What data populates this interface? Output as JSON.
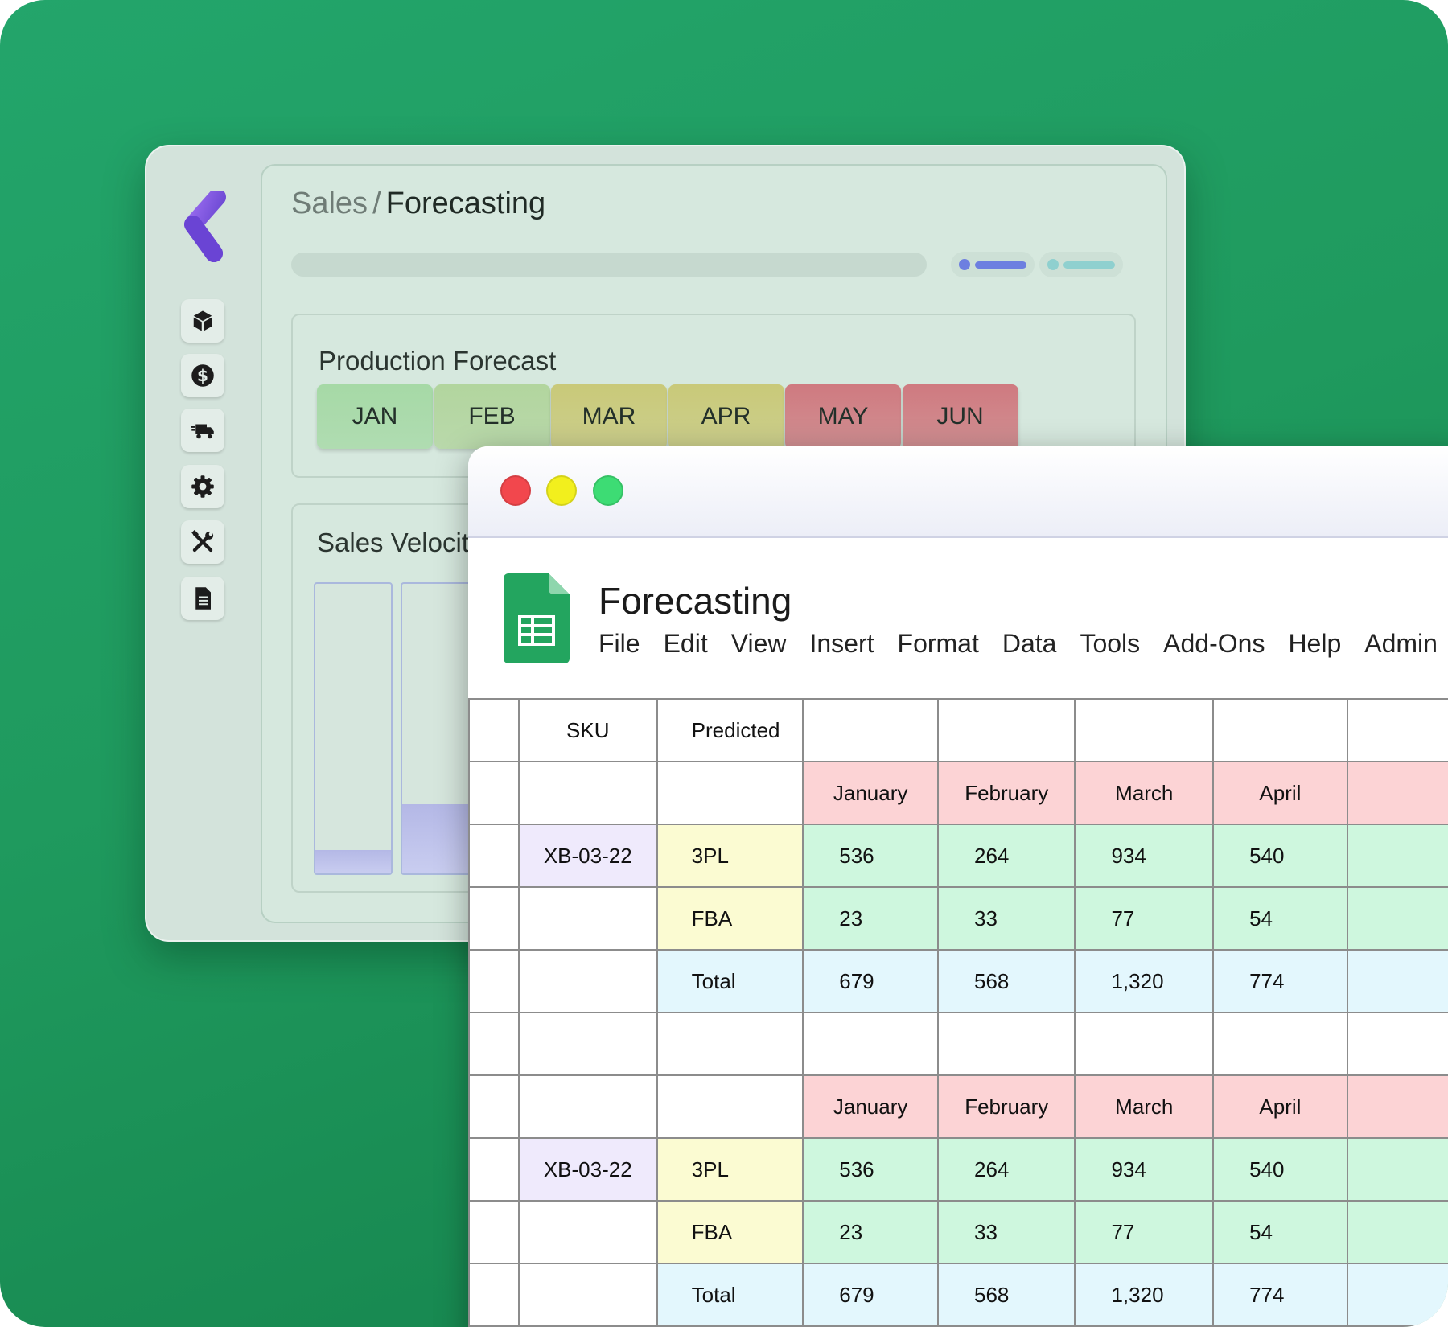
{
  "app": {
    "breadcrumb": {
      "parent": "Sales",
      "separator": "/",
      "current": "Forecasting"
    },
    "sidebar": {
      "items": [
        {
          "icon": "box-icon"
        },
        {
          "icon": "dollar-icon"
        },
        {
          "icon": "truck-icon"
        },
        {
          "icon": "gear-icon"
        },
        {
          "icon": "tools-icon"
        },
        {
          "icon": "document-icon"
        }
      ]
    },
    "production_forecast": {
      "title": "Production Forecast",
      "months": [
        {
          "label": "JAN",
          "color": "#a6d9a6"
        },
        {
          "label": "FEB",
          "color": "#b2d59e"
        },
        {
          "label": "MAR",
          "color": "#c9c979"
        },
        {
          "label": "APR",
          "color": "#c9c979"
        },
        {
          "label": "MAY",
          "color": "#cf7a80"
        },
        {
          "label": "JUN",
          "color": "#cf7a80"
        }
      ]
    },
    "sales_velocity": {
      "title": "Sales Velocit",
      "bars": [
        {
          "level": 0.08
        },
        {
          "level": 0.24
        }
      ]
    }
  },
  "sheet": {
    "title": "Forecasting",
    "menu": [
      "File",
      "Edit",
      "View",
      "Insert",
      "Format",
      "Data",
      "Tools",
      "Add-Ons",
      "Help",
      "Admin"
    ],
    "header": {
      "sku": "SKU",
      "predicted": "Predicted"
    },
    "months": [
      "January",
      "February",
      "March",
      "April"
    ],
    "blocks": [
      {
        "sku": "XB-03-22",
        "rows": [
          {
            "label": "3PL",
            "values": [
              "536",
              "264",
              "934",
              "540"
            ]
          },
          {
            "label": "FBA",
            "values": [
              "23",
              "33",
              "77",
              "54"
            ]
          },
          {
            "label": "Total",
            "values": [
              "679",
              "568",
              "1,320",
              "774"
            ]
          }
        ]
      },
      {
        "sku": "XB-03-22",
        "rows": [
          {
            "label": "3PL",
            "values": [
              "536",
              "264",
              "934",
              "540"
            ]
          },
          {
            "label": "FBA",
            "values": [
              "23",
              "33",
              "77",
              "54"
            ]
          },
          {
            "label": "Total",
            "values": [
              "679",
              "568",
              "1,320",
              "774"
            ]
          }
        ]
      }
    ]
  },
  "colors": {
    "background": "#1f9a5e",
    "traffic_close": "#f2474d",
    "traffic_minimize": "#f2ef1d",
    "traffic_maximize": "#3ddc74",
    "sheets_green": "#23a55f",
    "logo_purple": "#7a4de0"
  }
}
